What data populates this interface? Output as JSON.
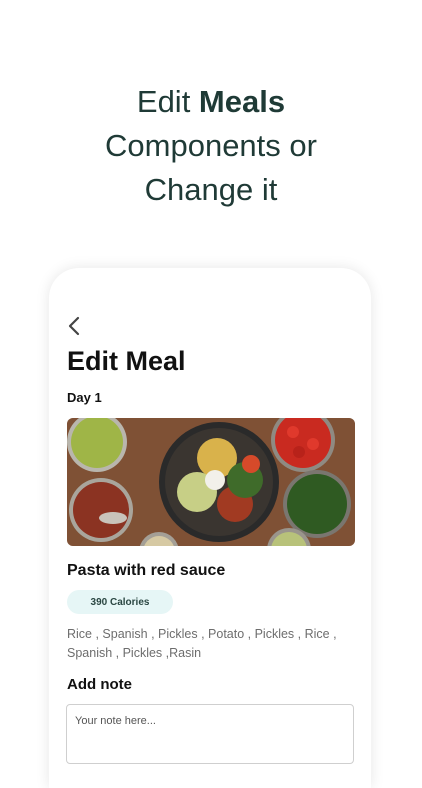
{
  "promo": {
    "line1_prefix": "Edit ",
    "line1_bold": "Meals",
    "line2": "Components or",
    "line3": "Change it"
  },
  "screen": {
    "back_icon": "chevron-left-icon",
    "title": "Edit Meal",
    "day_label": "Day 1",
    "meal_name": "Pasta with red sauce",
    "calories": "390 Calories",
    "components": "Rice , Spanish , Pickles , Potato , Pickles , Rice , Spanish , Pickles ,Rasin",
    "add_note_label": "Add note",
    "note_placeholder": "Your note here..."
  },
  "colors": {
    "headline": "#1f3a36",
    "calorie_badge_bg": "#e6f6f6",
    "text_muted": "#6d6d6d"
  }
}
